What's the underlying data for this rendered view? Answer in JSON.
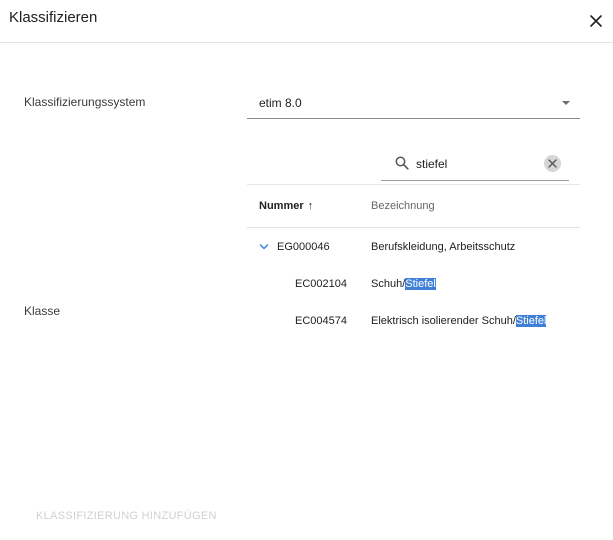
{
  "dialog": {
    "title": "Klassifizieren"
  },
  "form": {
    "system_label": "Klassifizierungssystem",
    "system_value": "etim 8.0",
    "klasse_label": "Klasse"
  },
  "search": {
    "value": "stiefel"
  },
  "table": {
    "columns": {
      "nummer": "Nummer",
      "nummer_sort": "↑",
      "bezeichnung": "Bezeichnung"
    },
    "rows": [
      {
        "nummer": "EG000046",
        "bezeichnung": "Berufskleidung, Arbeitsschutz",
        "bez_prefix": "Berufskleidung, Arbeitsschutz",
        "bez_match": ""
      },
      {
        "nummer": "EC002104",
        "bezeichnung": "Schuh/Stiefel",
        "bez_prefix": "Schuh/",
        "bez_match": "Stiefel"
      },
      {
        "nummer": "EC004574",
        "bezeichnung": "Elektrisch isolierender Schuh/Stiefel",
        "bez_prefix": "Elektrisch isolierender Schuh/",
        "bez_match": "Stiefel"
      }
    ]
  },
  "actions": {
    "add_label": "KLASSIFIZIERUNG HINZUFÜGEN"
  },
  "colors": {
    "accent": "#3f7fd6",
    "disabled": "#d0d0d0"
  },
  "icons": {
    "close": "close-icon",
    "search": "search-icon",
    "clear": "clear-icon",
    "expand": "chevron-down-icon",
    "sort": "arrow-up-icon"
  }
}
